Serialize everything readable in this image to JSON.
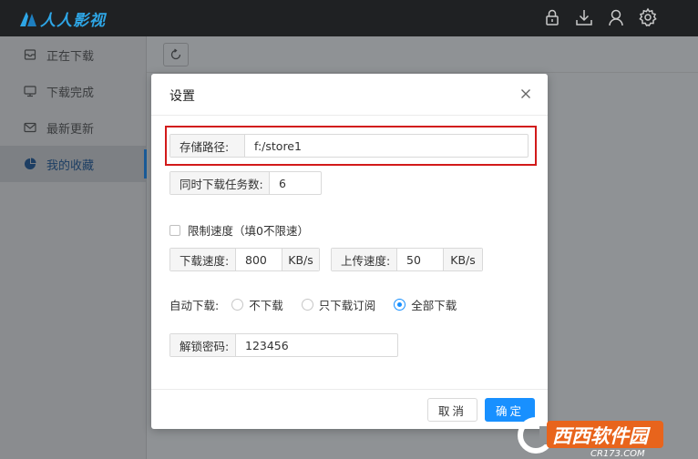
{
  "app": {
    "logo_text": "人人影视",
    "brand_color": "#2ea6e6",
    "top_icons": [
      "lock-icon",
      "download-icon",
      "user-icon",
      "gear-icon"
    ]
  },
  "sidebar": {
    "items": [
      {
        "label": "正在下载",
        "icon": "inbox-icon"
      },
      {
        "label": "下载完成",
        "icon": "monitor-icon"
      },
      {
        "label": "最新更新",
        "icon": "mail-icon"
      },
      {
        "label": "我的收藏",
        "icon": "pie-chart-icon",
        "active": true
      }
    ]
  },
  "dialog": {
    "title": "设置",
    "storage_path": {
      "label": "存储路径:",
      "value": "f:/store1"
    },
    "tasks": {
      "label": "同时下载任务数:",
      "value": "6"
    },
    "limit_speed": {
      "label": "限制速度（填0不限速）",
      "checked": false
    },
    "download_speed": {
      "label": "下载速度:",
      "value": "800",
      "unit": "KB/s"
    },
    "upload_speed": {
      "label": "上传速度:",
      "value": "50",
      "unit": "KB/s"
    },
    "auto_download": {
      "label": "自动下载:",
      "options": [
        "不下载",
        "只下载订阅",
        "全部下载"
      ],
      "selected": "全部下载"
    },
    "unlock_password": {
      "label": "解锁密码:",
      "value": "123456"
    },
    "cancel_label": "取消",
    "ok_label": "确定",
    "accent_color": "#1890ff",
    "highlight_color": "#d21a1a"
  },
  "watermark": {
    "text": "西西软件园",
    "sub": "CR173.COM"
  }
}
